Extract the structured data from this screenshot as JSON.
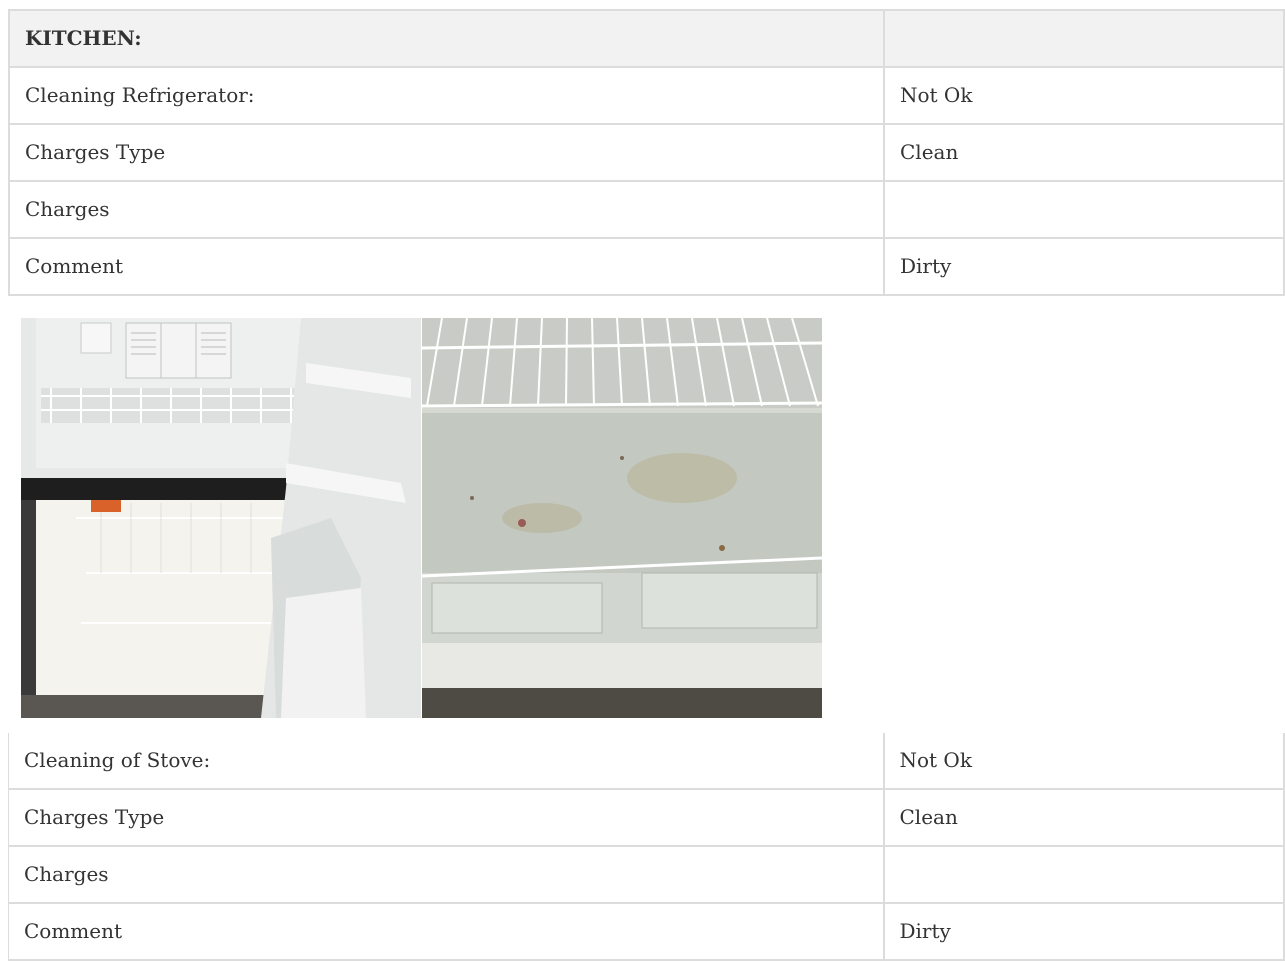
{
  "kitchen": {
    "heading": "KITCHEN:",
    "heading_value": "",
    "rows": [
      {
        "label": "Cleaning Refrigerator:",
        "value": "Not Ok"
      },
      {
        "label": "Charges Type",
        "value": "Clean"
      },
      {
        "label": "Charges",
        "value": ""
      },
      {
        "label": "Comment",
        "value": "Dirty"
      }
    ]
  },
  "photos": [
    {
      "alt": "refrigerator-interior-photo"
    },
    {
      "alt": "refrigerator-shelf-closeup-photo"
    }
  ],
  "stove": {
    "rows": [
      {
        "label": "Cleaning of Stove:",
        "value": "Not Ok"
      },
      {
        "label": "Charges Type",
        "value": "Clean"
      },
      {
        "label": "Charges",
        "value": ""
      },
      {
        "label": "Comment",
        "value": "Dirty"
      }
    ]
  }
}
